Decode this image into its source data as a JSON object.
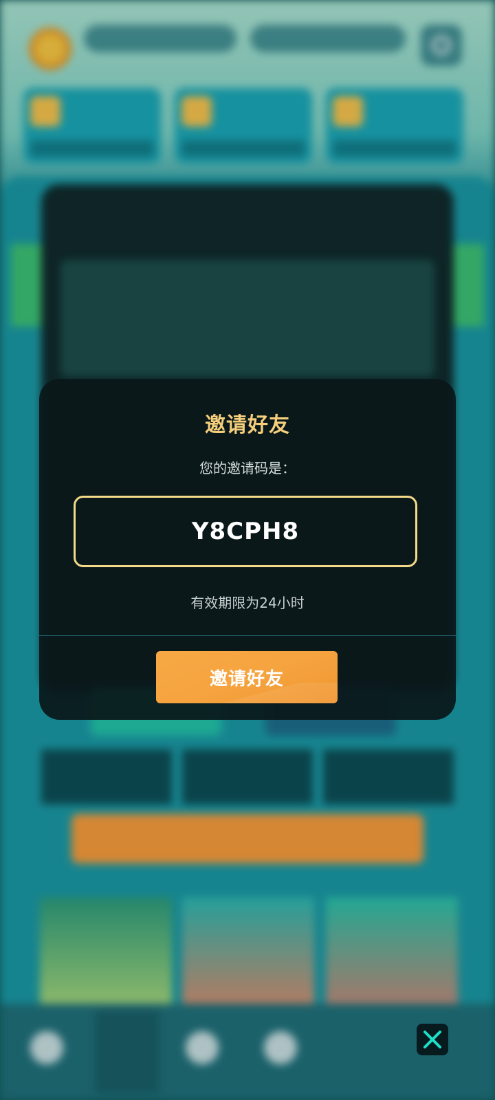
{
  "modal": {
    "title": "邀请好友",
    "code_label": "您的邀请码是：",
    "invite_code": "Y8CPH8",
    "validity_text": "有效期限为24小时",
    "invite_button_label": "邀请好友"
  },
  "close_button": {
    "icon": "close-icon"
  },
  "colors": {
    "accent_gold": "#f5cf7c",
    "button_orange": "#f5a33f",
    "close_x": "#1ce0c8"
  }
}
